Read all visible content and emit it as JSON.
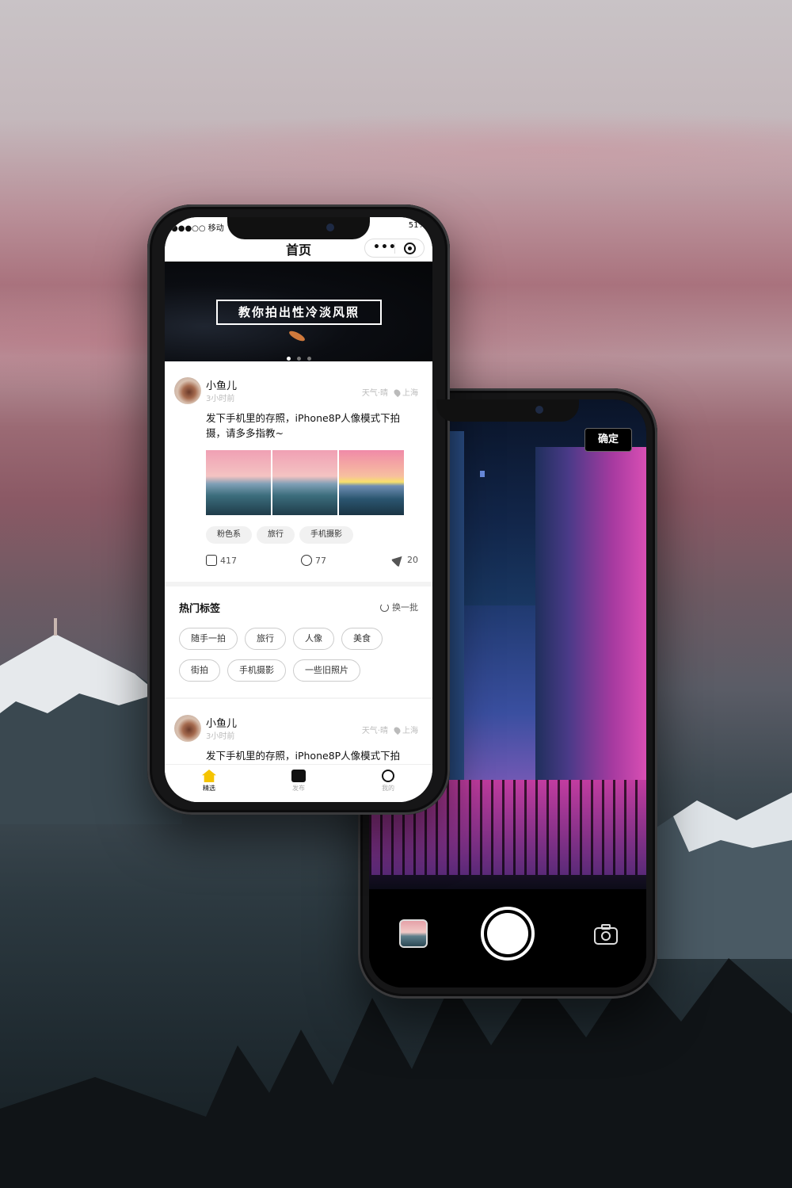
{
  "colors": {
    "accent": "#f5c400",
    "text": "#111111",
    "muted": "#bbbbbb"
  },
  "front": {
    "status": {
      "carrier": "●●●○○ 移动",
      "battery": "51%"
    },
    "nav": {
      "title": "首页"
    },
    "banner": {
      "caption": "教你拍出性冷淡风照",
      "pages": 3,
      "active_page": 1
    },
    "post1": {
      "username": "小鱼儿",
      "time": "3小时前",
      "weather": "天气·晴",
      "location": "上海",
      "text": "发下手机里的存照，iPhone8P人像模式下拍摄，请多多指教~",
      "tags": [
        "粉色系",
        "旅行",
        "手机摄影"
      ],
      "likes": "417",
      "comments": "77",
      "shares": "20"
    },
    "hot_tags": {
      "title": "热门标签",
      "refresh": "换一批",
      "items": [
        "随手一拍",
        "旅行",
        "人像",
        "美食",
        "街拍",
        "手机摄影",
        "一些旧照片"
      ]
    },
    "post2": {
      "username": "小鱼儿",
      "time": "3小时前",
      "weather": "天气·晴",
      "location": "上海",
      "text": "发下手机里的存照，iPhone8P人像模式下拍"
    },
    "tabs": [
      {
        "label": "精选",
        "icon": "home-icon",
        "active": true
      },
      {
        "label": "发布",
        "icon": "camera-icon",
        "active": false
      },
      {
        "label": "我的",
        "icon": "smile-icon",
        "active": false
      }
    ]
  },
  "back": {
    "confirm": "确定",
    "icons": {
      "gallery": "gallery-thumbnail-icon",
      "shutter": "shutter-icon",
      "flip": "flip-camera-icon"
    }
  }
}
